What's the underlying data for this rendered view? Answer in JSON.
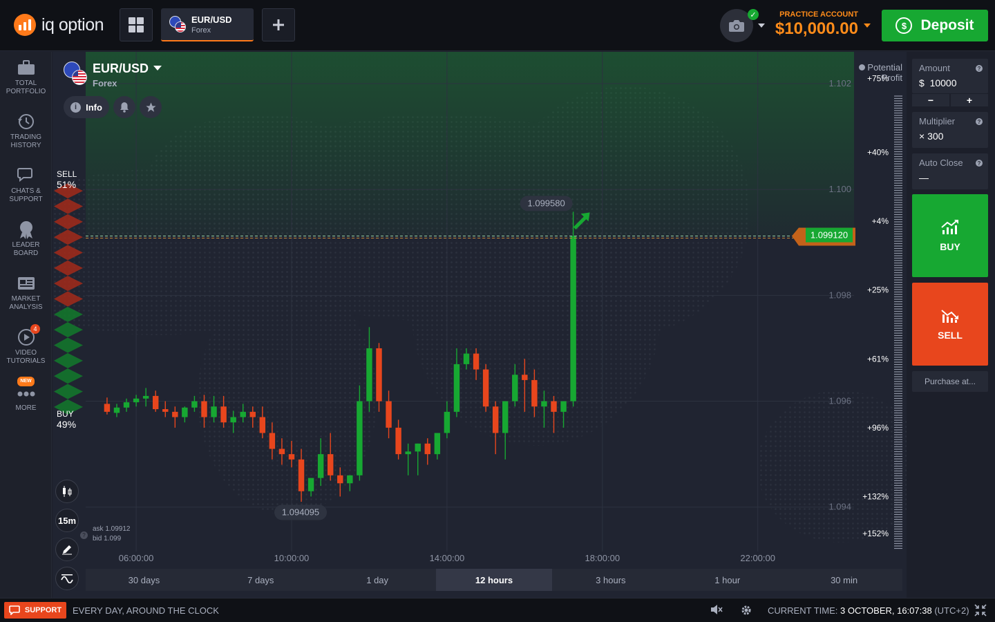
{
  "app": {
    "logo_text": "iq option"
  },
  "topbar": {
    "grid_icon": "grid-icon",
    "active_tab": {
      "symbol": "EUR/USD",
      "type": "Forex"
    },
    "add_tab_icon": "plus-icon",
    "account_label": "PRACTICE ACCOUNT",
    "account_balance": "$10,000.00",
    "deposit_label": "Deposit"
  },
  "sidebar": {
    "items": [
      {
        "label1": "TOTAL",
        "label2": "PORTFOLIO",
        "icon": "briefcase-icon"
      },
      {
        "label1": "TRADING",
        "label2": "HISTORY",
        "icon": "history-icon"
      },
      {
        "label1": "CHATS &",
        "label2": "SUPPORT",
        "icon": "chat-icon"
      },
      {
        "label1": "LEADER",
        "label2": "BOARD",
        "icon": "medal-icon"
      },
      {
        "label1": "MARKET",
        "label2": "ANALYSIS",
        "icon": "newspaper-icon"
      },
      {
        "label1": "VIDEO",
        "label2": "TUTORIALS",
        "icon": "play-icon",
        "badge": "4"
      },
      {
        "label1": "MORE",
        "label2": "",
        "icon": "more-icon",
        "badge": "NEW"
      }
    ]
  },
  "chart_header": {
    "symbol": "EUR/USD",
    "type": "Forex",
    "info_label": "Info",
    "potential_profit_1": "Potential",
    "potential_profit_2": "Profit"
  },
  "sentiment": {
    "sell_label": "SELL",
    "sell_pct": "51%",
    "buy_label": "BUY",
    "buy_pct": "49%",
    "sell_fraction": 0.51
  },
  "tools": {
    "timeframe": "15m"
  },
  "quote": {
    "ask": "ask 1.09912",
    "bid": "bid 1.099"
  },
  "ranges": [
    "30 days",
    "7 days",
    "1 day",
    "12 hours",
    "3 hours",
    "1 hour",
    "30 min"
  ],
  "active_range": "12 hours",
  "right_panel": {
    "amount_label": "Amount",
    "amount_currency": "$",
    "amount_value": "10000",
    "minus": "−",
    "plus": "+",
    "multiplier_label": "Multiplier",
    "multiplier_value": "× 300",
    "auto_close_label": "Auto Close",
    "auto_close_value": "—",
    "buy_label": "BUY",
    "sell_label": "SELL",
    "purchase_label": "Purchase at..."
  },
  "footer": {
    "support_label": "SUPPORT",
    "tagline": "EVERY DAY, AROUND THE CLOCK",
    "time_label": "CURRENT TIME:",
    "time_value": "3 OCTOBER, 16:07:38",
    "timezone": "(UTC+2)"
  },
  "colors": {
    "up": "#17a832",
    "down": "#e8461d",
    "accent": "#ff8c1a",
    "bg": "#202431"
  },
  "chart_data": {
    "type": "candlestick",
    "symbol": "EUR/USD",
    "y_ticks": [
      "1.102",
      "1.100",
      "1.098",
      "1.096",
      "1.094"
    ],
    "y_tick_values": [
      1.102,
      1.1,
      1.098,
      1.096,
      1.094
    ],
    "ylim": [
      1.0929,
      1.1026
    ],
    "x_ticks": [
      "06:00:00",
      "10:00:00",
      "14:00:00",
      "18:00:00",
      "22:00:00"
    ],
    "x_tick_hours": [
      6,
      10,
      14,
      18,
      22
    ],
    "xlim_hours": [
      4.7,
      24.3
    ],
    "current_price": "1.099120",
    "current_price_value": 1.09912,
    "high_label": "1.099580",
    "high_value": 1.09958,
    "low_label": "1.094095",
    "low_value": 1.094095,
    "profit_scale": [
      {
        "label": "+75%",
        "value": 1.1021
      },
      {
        "label": "+40%",
        "value": 1.1007
      },
      {
        "label": "+4%",
        "value": 1.0994
      },
      {
        "label": "+25%",
        "value": 1.0981
      },
      {
        "label": "+61%",
        "value": 1.0968
      },
      {
        "label": "+96%",
        "value": 1.0955
      },
      {
        "label": "+132%",
        "value": 1.0942
      },
      {
        "label": "+152%",
        "value": 1.0935
      }
    ],
    "candle_interval_minutes": 15,
    "first_candle_hour": 5.25,
    "candles": [
      [
        1.09595,
        1.09607,
        1.0958,
        1.09575
      ],
      [
        1.09578,
        1.09595,
        1.09588,
        1.0957
      ],
      [
        1.09588,
        1.09605,
        1.09598,
        1.0958
      ],
      [
        1.09598,
        1.09612,
        1.09605,
        1.0959
      ],
      [
        1.09605,
        1.09625,
        1.0961,
        1.0959
      ],
      [
        1.0961,
        1.0962,
        1.09585,
        1.0958
      ],
      [
        1.09585,
        1.096,
        1.0958,
        1.0957
      ],
      [
        1.0958,
        1.0959,
        1.0957,
        1.0955
      ],
      [
        1.0957,
        1.0959,
        1.09588,
        1.0956
      ],
      [
        1.09588,
        1.0961,
        1.096,
        1.0958
      ],
      [
        1.096,
        1.09612,
        1.0957,
        1.0955
      ],
      [
        1.0957,
        1.0961,
        1.0959,
        1.0956
      ],
      [
        1.0959,
        1.0961,
        1.0956,
        1.0955
      ],
      [
        1.0956,
        1.09582,
        1.0957,
        1.0954
      ],
      [
        1.0957,
        1.09595,
        1.0958,
        1.0956
      ],
      [
        1.0958,
        1.0959,
        1.0957,
        1.0955
      ],
      [
        1.0957,
        1.0959,
        1.0954,
        1.0953
      ],
      [
        1.0954,
        1.0956,
        1.0951,
        1.0949
      ],
      [
        1.0951,
        1.0953,
        1.095,
        1.0948
      ],
      [
        1.095,
        1.09525,
        1.0949,
        1.09475
      ],
      [
        1.0949,
        1.0951,
        1.0943,
        1.0941
      ],
      [
        1.0943,
        1.09455,
        1.09455,
        1.0942
      ],
      [
        1.09455,
        1.0953,
        1.095,
        1.0944
      ],
      [
        1.095,
        1.0954,
        1.0946,
        1.0945
      ],
      [
        1.0946,
        1.09475,
        1.09445,
        1.0942
      ],
      [
        1.09445,
        1.0946,
        1.0946,
        1.0943
      ],
      [
        1.0946,
        1.0963,
        1.096,
        1.0945
      ],
      [
        1.096,
        1.0974,
        1.097,
        1.0958
      ],
      [
        1.097,
        1.0971,
        1.096,
        1.0958
      ],
      [
        1.096,
        1.0962,
        1.0955,
        1.0953
      ],
      [
        1.0955,
        1.09565,
        1.095,
        1.0949
      ],
      [
        1.095,
        1.0952,
        1.09505,
        1.0946
      ],
      [
        1.09505,
        1.0952,
        1.0952,
        1.0946
      ],
      [
        1.0952,
        1.0953,
        1.095,
        1.0948
      ],
      [
        1.095,
        1.0953,
        1.0954,
        1.0949
      ],
      [
        1.0954,
        1.096,
        1.0958,
        1.0953
      ],
      [
        1.0958,
        1.097,
        1.0967,
        1.0957
      ],
      [
        1.0967,
        1.097,
        1.0969,
        1.0966
      ],
      [
        1.0969,
        1.097,
        1.0966,
        1.0964
      ],
      [
        1.0966,
        1.0967,
        1.0959,
        1.0958
      ],
      [
        1.0959,
        1.096,
        1.0954,
        1.095
      ],
      [
        1.0954,
        1.096,
        1.096,
        1.0949
      ],
      [
        1.096,
        1.0967,
        1.0965,
        1.0959
      ],
      [
        1.0965,
        1.0968,
        1.0964,
        1.0958
      ],
      [
        1.0964,
        1.0966,
        1.0959,
        1.0957
      ],
      [
        1.0959,
        1.0962,
        1.096,
        1.0955
      ],
      [
        1.096,
        1.0961,
        1.0958,
        1.0954
      ],
      [
        1.0958,
        1.096,
        1.096,
        1.0955
      ],
      [
        1.096,
        1.09958,
        1.09912,
        1.0959
      ]
    ]
  }
}
